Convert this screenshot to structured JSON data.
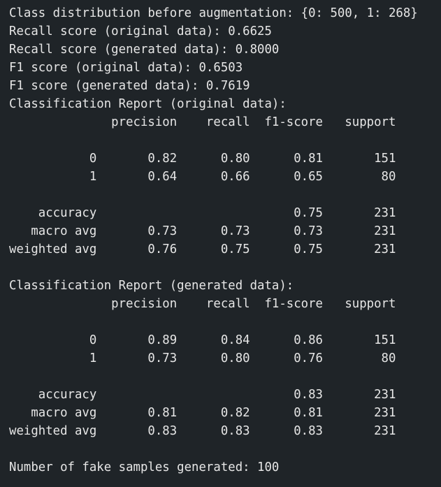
{
  "theme": {
    "background": "#1f2428",
    "text": "#e6e6e6"
  },
  "output": {
    "lines": [
      "Class distribution before augmentation: {0: 500, 1: 268}",
      "Recall score (original data): 0.6625",
      "Recall score (generated data): 0.8000",
      "F1 score (original data): 0.6503",
      "F1 score (generated data): 0.7619",
      "Classification Report (original data):",
      "              precision    recall  f1-score   support",
      "",
      "           0       0.82      0.80      0.81       151",
      "           1       0.64      0.66      0.65        80",
      "",
      "    accuracy                           0.75       231",
      "   macro avg       0.73      0.73      0.73       231",
      "weighted avg       0.76      0.75      0.75       231",
      "",
      "Classification Report (generated data):",
      "              precision    recall  f1-score   support",
      "",
      "           0       0.89      0.84      0.86       151",
      "           1       0.73      0.80      0.76        80",
      "",
      "    accuracy                           0.83       231",
      "   macro avg       0.81      0.82      0.81       231",
      "weighted avg       0.83      0.83      0.83       231",
      "",
      "Number of fake samples generated: 100"
    ]
  }
}
